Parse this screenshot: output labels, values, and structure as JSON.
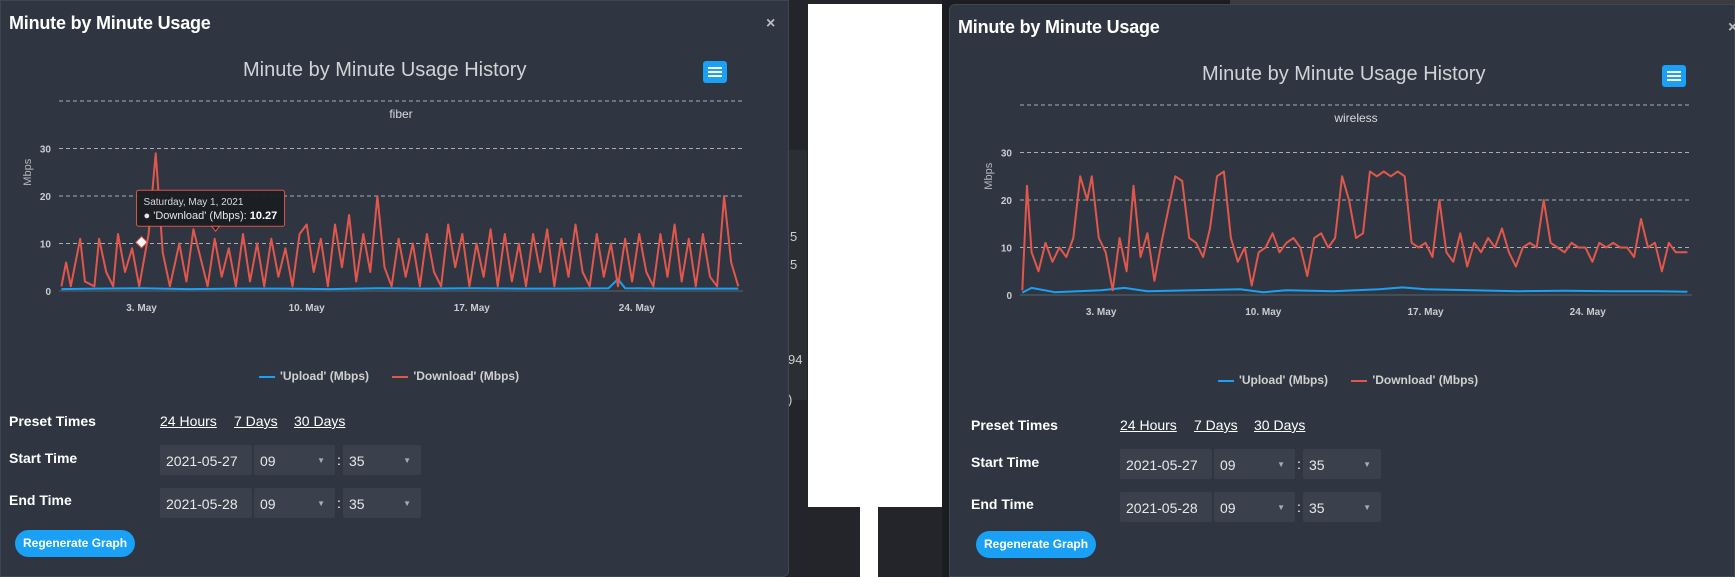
{
  "background": {
    "numbers": [
      "5",
      "5",
      "94",
      ")"
    ]
  },
  "panels": [
    {
      "title": "Minute by Minute Usage",
      "close": "×",
      "chart_title": "Minute by Minute Usage History",
      "subtitle": "fiber",
      "tooltip": {
        "date": "Saturday, May 1, 2021",
        "series": "'Download' (Mbps): ",
        "value": "10.27"
      },
      "preset_label": "Preset Times",
      "presets": [
        "24 Hours",
        "7 Days",
        "30 Days"
      ],
      "start_label": "Start Time",
      "end_label": "End Time",
      "start": {
        "date": "2021-05-27",
        "hour": "09",
        "minute": "35"
      },
      "end": {
        "date": "2021-05-28",
        "hour": "09",
        "minute": "35"
      },
      "colon": ":",
      "regenerate": "Regenerate Graph"
    },
    {
      "title": "Minute by Minute Usage",
      "close": "×",
      "chart_title": "Minute by Minute Usage History",
      "subtitle": "wireless",
      "preset_label": "Preset Times",
      "presets": [
        "24 Hours",
        "7 Days",
        "30 Days"
      ],
      "start_label": "Start Time",
      "end_label": "End Time",
      "start": {
        "date": "2021-05-27",
        "hour": "09",
        "minute": "35"
      },
      "end": {
        "date": "2021-05-28",
        "hour": "09",
        "minute": "35"
      },
      "colon": ":",
      "regenerate": "Regenerate Graph"
    }
  ],
  "chart_data": [
    {
      "type": "line",
      "title": "Minute by Minute Usage History",
      "subtitle": "fiber",
      "ylabel": "Mbps",
      "ylim": [
        0,
        40
      ],
      "yticks": [
        "0",
        "10",
        "20",
        "30"
      ],
      "xlim": [
        -1.5,
        27.5
      ],
      "xticks": [
        {
          "label": "3. May",
          "x": 2
        },
        {
          "label": "10. May",
          "x": 9
        },
        {
          "label": "17. May",
          "x": 16
        },
        {
          "label": "24. May",
          "x": 23
        }
      ],
      "colors": {
        "upload": "#1aa1f5",
        "download": "#e2574c"
      },
      "series": [
        {
          "name": "'Upload' (Mbps)",
          "values": [
            [
              -1.4,
              0.4
            ],
            [
              0,
              0.5
            ],
            [
              2,
              0.6
            ],
            [
              4,
              0.4
            ],
            [
              6,
              0.5
            ],
            [
              8,
              0.5
            ],
            [
              10,
              0.4
            ],
            [
              12,
              0.6
            ],
            [
              14,
              0.5
            ],
            [
              16,
              0.6
            ],
            [
              18,
              0.5
            ],
            [
              20,
              0.5
            ],
            [
              21.8,
              0.6
            ],
            [
              22.2,
              2.5
            ],
            [
              22.5,
              0.6
            ],
            [
              24,
              0.5
            ],
            [
              26,
              0.5
            ],
            [
              27.3,
              0.5
            ]
          ]
        },
        {
          "name": "'Download' (Mbps)",
          "values": [
            [
              -1.4,
              1
            ],
            [
              -1.2,
              6
            ],
            [
              -1.0,
              1
            ],
            [
              -0.6,
              11
            ],
            [
              -0.4,
              2
            ],
            [
              0,
              1
            ],
            [
              0.2,
              11
            ],
            [
              0.5,
              4
            ],
            [
              0.8,
              1
            ],
            [
              1.0,
              12
            ],
            [
              1.3,
              4
            ],
            [
              1.6,
              9
            ],
            [
              1.9,
              1
            ],
            [
              2.3,
              12
            ],
            [
              2.6,
              29
            ],
            [
              2.9,
              8
            ],
            [
              3.2,
              1
            ],
            [
              3.6,
              10
            ],
            [
              3.9,
              2
            ],
            [
              4.2,
              13
            ],
            [
              4.5,
              7
            ],
            [
              4.8,
              1
            ],
            [
              5.1,
              11
            ],
            [
              5.4,
              3
            ],
            [
              5.7,
              9
            ],
            [
              6.0,
              1
            ],
            [
              6.3,
              12
            ],
            [
              6.6,
              2
            ],
            [
              6.9,
              10
            ],
            [
              7.2,
              1
            ],
            [
              7.5,
              11
            ],
            [
              7.8,
              3
            ],
            [
              8.1,
              9
            ],
            [
              8.4,
              1
            ],
            [
              8.7,
              12
            ],
            [
              9.0,
              14
            ],
            [
              9.3,
              4
            ],
            [
              9.6,
              11
            ],
            [
              9.9,
              1
            ],
            [
              10.2,
              14
            ],
            [
              10.5,
              5
            ],
            [
              10.8,
              16
            ],
            [
              11.1,
              2
            ],
            [
              11.4,
              12
            ],
            [
              11.7,
              4
            ],
            [
              12.0,
              20
            ],
            [
              12.3,
              5
            ],
            [
              12.6,
              1
            ],
            [
              12.9,
              11
            ],
            [
              13.2,
              3
            ],
            [
              13.5,
              10
            ],
            [
              13.8,
              1
            ],
            [
              14.1,
              12
            ],
            [
              14.4,
              4
            ],
            [
              14.7,
              1
            ],
            [
              15.0,
              14
            ],
            [
              15.3,
              5
            ],
            [
              15.6,
              12
            ],
            [
              15.9,
              1
            ],
            [
              16.2,
              10
            ],
            [
              16.5,
              3
            ],
            [
              16.8,
              13
            ],
            [
              17.1,
              1
            ],
            [
              17.4,
              12
            ],
            [
              17.7,
              2
            ],
            [
              18.0,
              10
            ],
            [
              18.3,
              1
            ],
            [
              18.6,
              12
            ],
            [
              18.9,
              4
            ],
            [
              19.2,
              13
            ],
            [
              19.5,
              1
            ],
            [
              19.8,
              11
            ],
            [
              20.1,
              3
            ],
            [
              20.4,
              14
            ],
            [
              20.7,
              4
            ],
            [
              21.0,
              1
            ],
            [
              21.3,
              12
            ],
            [
              21.6,
              3
            ],
            [
              21.9,
              10
            ],
            [
              22.2,
              1
            ],
            [
              22.5,
              11
            ],
            [
              22.8,
              2
            ],
            [
              23.1,
              12
            ],
            [
              23.4,
              4
            ],
            [
              23.7,
              1
            ],
            [
              24.0,
              12
            ],
            [
              24.3,
              3
            ],
            [
              24.6,
              14
            ],
            [
              24.9,
              2
            ],
            [
              25.2,
              11
            ],
            [
              25.5,
              1
            ],
            [
              25.8,
              12
            ],
            [
              26.1,
              3
            ],
            [
              26.4,
              1
            ],
            [
              26.7,
              20
            ],
            [
              27.0,
              6
            ],
            [
              27.3,
              1
            ]
          ]
        }
      ],
      "legend": "bottom-center",
      "grid": true
    },
    {
      "type": "line",
      "title": "Minute by Minute Usage History",
      "subtitle": "wireless",
      "ylabel": "Mbps",
      "ylim": [
        0,
        40
      ],
      "yticks": [
        "0",
        "10",
        "20",
        "30"
      ],
      "xlim": [
        -1.5,
        27.5
      ],
      "xticks": [
        {
          "label": "3. May",
          "x": 2
        },
        {
          "label": "10. May",
          "x": 9
        },
        {
          "label": "17. May",
          "x": 16
        },
        {
          "label": "24. May",
          "x": 23
        }
      ],
      "colors": {
        "upload": "#1aa1f5",
        "download": "#e2574c"
      },
      "series": [
        {
          "name": "'Upload' (Mbps)",
          "values": [
            [
              -1.4,
              0.5
            ],
            [
              -1.0,
              1.5
            ],
            [
              0,
              0.6
            ],
            [
              2,
              1
            ],
            [
              3,
              1.5
            ],
            [
              4,
              0.8
            ],
            [
              6,
              1
            ],
            [
              8,
              1.2
            ],
            [
              9,
              0.6
            ],
            [
              10,
              1
            ],
            [
              12,
              0.8
            ],
            [
              14,
              1.2
            ],
            [
              15,
              1.6
            ],
            [
              16,
              1.2
            ],
            [
              18,
              1
            ],
            [
              20,
              0.8
            ],
            [
              22,
              0.9
            ],
            [
              24,
              0.8
            ],
            [
              26,
              0.8
            ],
            [
              27.3,
              0.7
            ]
          ]
        },
        {
          "name": "'Download' (Mbps)",
          "values": [
            [
              -1.4,
              1
            ],
            [
              -1.2,
              23
            ],
            [
              -1.0,
              9
            ],
            [
              -0.7,
              5
            ],
            [
              -0.4,
              11
            ],
            [
              -0.1,
              7
            ],
            [
              0.2,
              10
            ],
            [
              0.5,
              8
            ],
            [
              0.8,
              12
            ],
            [
              1.1,
              25
            ],
            [
              1.4,
              20
            ],
            [
              1.6,
              25
            ],
            [
              1.9,
              12
            ],
            [
              2.2,
              9
            ],
            [
              2.5,
              1
            ],
            [
              2.8,
              12
            ],
            [
              3.1,
              5
            ],
            [
              3.4,
              23
            ],
            [
              3.7,
              8
            ],
            [
              4.0,
              13
            ],
            [
              4.3,
              3
            ],
            [
              4.6,
              11
            ],
            [
              4.9,
              18
            ],
            [
              5.2,
              25
            ],
            [
              5.5,
              24
            ],
            [
              5.8,
              12
            ],
            [
              6.1,
              11
            ],
            [
              6.4,
              8
            ],
            [
              6.7,
              14
            ],
            [
              7.0,
              25
            ],
            [
              7.3,
              26
            ],
            [
              7.6,
              12
            ],
            [
              7.9,
              7
            ],
            [
              8.2,
              10
            ],
            [
              8.5,
              2
            ],
            [
              8.8,
              9
            ],
            [
              9.1,
              10
            ],
            [
              9.4,
              13
            ],
            [
              9.7,
              9
            ],
            [
              10.0,
              11
            ],
            [
              10.3,
              12
            ],
            [
              10.6,
              10
            ],
            [
              10.9,
              4
            ],
            [
              11.2,
              12
            ],
            [
              11.5,
              13
            ],
            [
              11.8,
              10
            ],
            [
              12.1,
              12
            ],
            [
              12.4,
              25
            ],
            [
              12.7,
              20
            ],
            [
              13.0,
              12
            ],
            [
              13.3,
              13
            ],
            [
              13.6,
              26
            ],
            [
              13.9,
              25
            ],
            [
              14.2,
              26
            ],
            [
              14.5,
              25
            ],
            [
              14.8,
              26
            ],
            [
              15.1,
              25
            ],
            [
              15.4,
              11
            ],
            [
              15.7,
              10
            ],
            [
              16.0,
              11
            ],
            [
              16.3,
              8
            ],
            [
              16.6,
              20
            ],
            [
              16.9,
              9
            ],
            [
              17.2,
              7
            ],
            [
              17.5,
              13
            ],
            [
              17.8,
              6
            ],
            [
              18.1,
              11
            ],
            [
              18.4,
              9
            ],
            [
              18.7,
              12
            ],
            [
              19.0,
              10
            ],
            [
              19.3,
              14
            ],
            [
              19.6,
              9
            ],
            [
              19.9,
              6
            ],
            [
              20.2,
              10
            ],
            [
              20.5,
              11
            ],
            [
              20.8,
              10
            ],
            [
              21.1,
              20
            ],
            [
              21.4,
              11
            ],
            [
              21.7,
              10
            ],
            [
              22.0,
              9
            ],
            [
              22.3,
              11
            ],
            [
              22.6,
              10
            ],
            [
              22.9,
              10
            ],
            [
              23.2,
              7
            ],
            [
              23.5,
              11
            ],
            [
              23.8,
              10
            ],
            [
              24.1,
              11
            ],
            [
              24.4,
              10
            ],
            [
              24.7,
              10
            ],
            [
              25.0,
              8
            ],
            [
              25.3,
              16
            ],
            [
              25.6,
              10
            ],
            [
              25.9,
              11
            ],
            [
              26.2,
              5
            ],
            [
              26.5,
              11
            ],
            [
              26.8,
              9
            ],
            [
              27.3,
              9
            ]
          ]
        }
      ],
      "legend": "bottom-center",
      "grid": true
    }
  ]
}
